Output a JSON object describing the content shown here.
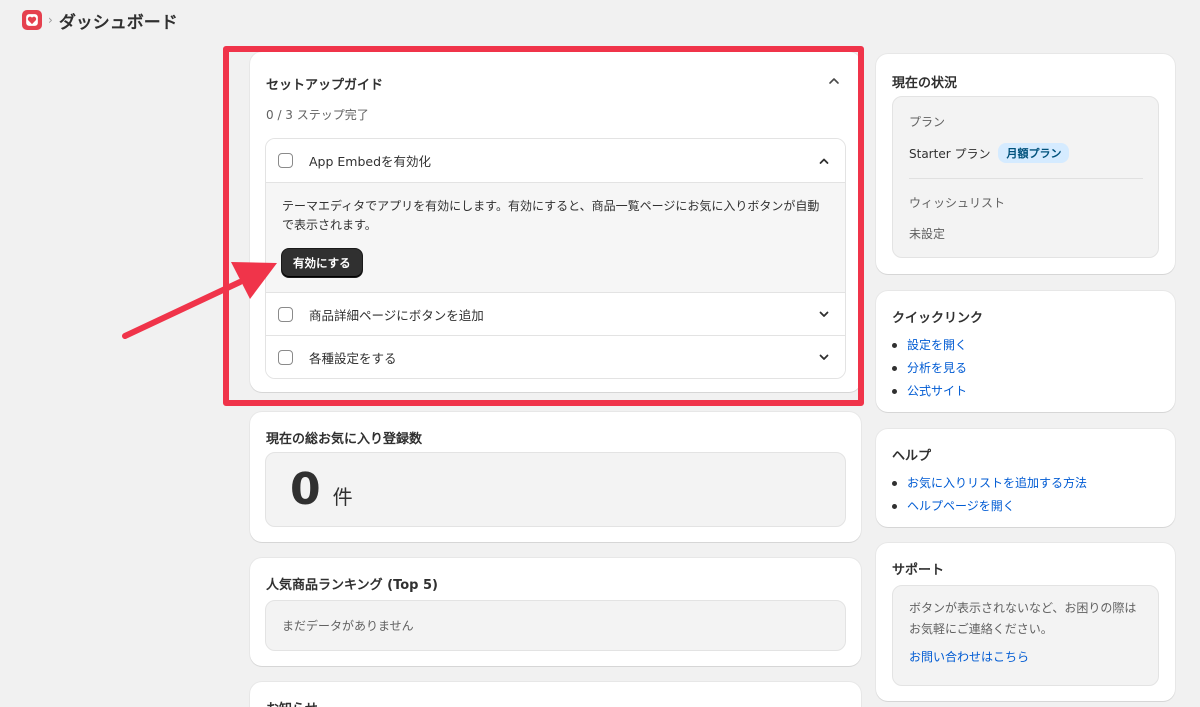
{
  "header": {
    "page_title": "ダッシュボード",
    "separator": "›"
  },
  "setup_guide": {
    "title": "セットアップガイド",
    "progress": "0 / 3 ステップ完了",
    "steps": [
      {
        "label": "App Embedを有効化",
        "expanded": true,
        "description": "テーマエディタでアプリを有効にします。有効にすると、商品一覧ページにお気に入りボタンが自動で表示されます。",
        "button_label": "有効にする"
      },
      {
        "label": "商品詳細ページにボタンを追加",
        "expanded": false
      },
      {
        "label": "各種設定をする",
        "expanded": false
      }
    ]
  },
  "total_favorites": {
    "title": "現在の総お気に入り登録数",
    "count": "0",
    "unit": "件"
  },
  "ranking": {
    "title": "人気商品ランキング (Top 5)",
    "empty_text": "まだデータがありません"
  },
  "news": {
    "title": "お知らせ"
  },
  "status": {
    "title": "現在の状況",
    "plan_label": "プラン",
    "plan_name": "Starter プラン",
    "plan_badge": "月額プラン",
    "wishlist_label": "ウィッシュリスト",
    "wishlist_value": "未設定"
  },
  "quick_links": {
    "title": "クイックリンク",
    "items": [
      "設定を開く",
      "分析を見る",
      "公式サイト"
    ]
  },
  "help": {
    "title": "ヘルプ",
    "items": [
      "お気に入りリストを追加する方法",
      "ヘルプページを開く"
    ]
  },
  "support": {
    "title": "サポート",
    "text": "ボタンが表示されないなど、お困りの際はお気軽にご連絡ください。",
    "link": "お問い合わせはこちら"
  },
  "colors": {
    "highlight": "#f0344a",
    "link": "#005bd3",
    "badge_bg": "#d5ebff",
    "app_icon": "#e5404e"
  }
}
